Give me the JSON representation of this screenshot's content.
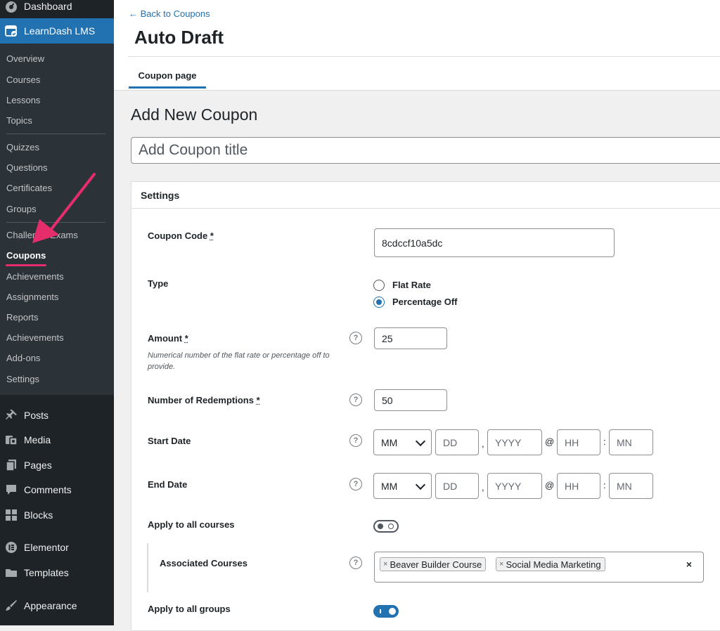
{
  "sidebar": {
    "dashboard": {
      "label": "Dashboard",
      "icon": "dashboard-icon"
    },
    "learndash": {
      "label": "LearnDash LMS",
      "icon": "learndash-icon"
    },
    "submenu": [
      {
        "label": "Overview"
      },
      {
        "label": "Courses"
      },
      {
        "label": "Lessons"
      },
      {
        "label": "Topics"
      },
      {
        "label": "Quizzes"
      },
      {
        "label": "Questions"
      },
      {
        "label": "Certificates"
      },
      {
        "label": "Groups"
      },
      {
        "label": "Challenge Exams"
      },
      {
        "label": "Coupons",
        "current": true
      },
      {
        "label": "Achievements"
      },
      {
        "label": "Assignments"
      },
      {
        "label": "Reports"
      },
      {
        "label": "Achievements"
      },
      {
        "label": "Add-ons"
      },
      {
        "label": "Settings"
      }
    ],
    "menu": [
      {
        "label": "Posts",
        "icon": "pin-icon"
      },
      {
        "label": "Media",
        "icon": "media-icon"
      },
      {
        "label": "Pages",
        "icon": "pages-icon"
      },
      {
        "label": "Comments",
        "icon": "comment-icon"
      },
      {
        "label": "Blocks",
        "icon": "blocks-icon"
      },
      {
        "label": "Elementor",
        "icon": "elementor-icon"
      },
      {
        "label": "Templates",
        "icon": "folder-icon"
      },
      {
        "label": "Appearance",
        "icon": "brush-icon"
      }
    ]
  },
  "header": {
    "back_link": "← Back to Coupons",
    "title": "Auto Draft",
    "tab": "Coupon page"
  },
  "main": {
    "section_title": "Add New Coupon",
    "title_placeholder": "Add Coupon title"
  },
  "settings": {
    "heading": "Settings",
    "coupon_code": {
      "label": "Coupon Code",
      "req": "*",
      "value": "8cdccf10a5dc"
    },
    "type": {
      "label": "Type",
      "options": [
        "Flat Rate",
        "Percentage Off"
      ],
      "selected": "Percentage Off"
    },
    "amount": {
      "label": "Amount",
      "req": "*",
      "description": "Numerical number of the flat rate or percentage off to provide.",
      "value": "25"
    },
    "redemptions": {
      "label": "Number of Redemptions",
      "req": "*",
      "value": "50"
    },
    "start_date": {
      "label": "Start Date",
      "month": "MM",
      "day": "DD",
      "year": "YYYY",
      "hour": "HH",
      "minute": "MN"
    },
    "end_date": {
      "label": "End Date",
      "month": "MM",
      "day": "DD",
      "year": "YYYY",
      "hour": "HH",
      "minute": "MN"
    },
    "date_separators": {
      "comma": ",",
      "at": "@",
      "colon": ":"
    },
    "help_glyph": "?",
    "apply_all_courses": {
      "label": "Apply to all courses",
      "on": false
    },
    "associated_courses": {
      "label": "Associated Courses",
      "tags": [
        "Beaver Builder Course",
        "Social Media Marketing"
      ],
      "tag_remove": "×",
      "clear": "×"
    },
    "apply_all_groups": {
      "label": "Apply to all groups",
      "on": true
    }
  },
  "colors": {
    "admin_blue": "#2271b1",
    "sidebar_bg": "#1d2327",
    "annotation": "#e62d6c"
  }
}
